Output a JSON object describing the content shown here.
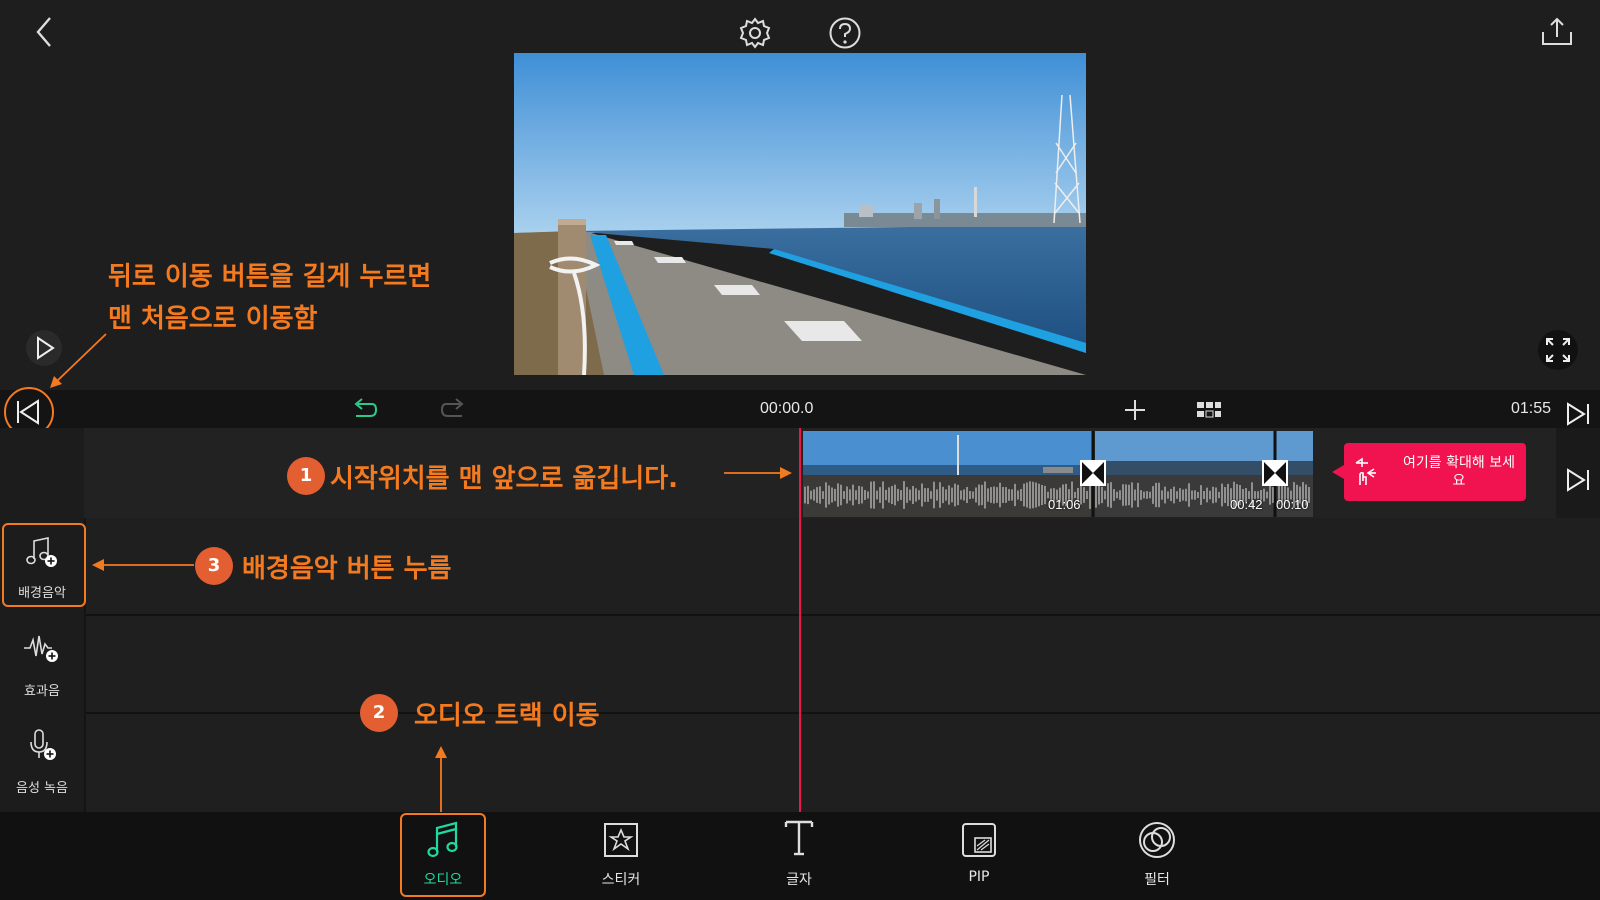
{
  "header": {
    "back_icon": "chevron-left-icon",
    "settings_icon": "gear-icon",
    "help_icon": "question-circle-icon",
    "export_icon": "share-upload-icon"
  },
  "preview": {
    "play_icon": "play-icon",
    "fullscreen_icon": "fullscreen-icon"
  },
  "toolbar": {
    "timecode": "00:00.0",
    "duration": "01:55",
    "icons": [
      "skip-to-start-icon",
      "undo-icon",
      "redo-icon",
      "add-icon",
      "grid-view-icon",
      "skip-to-end-icon"
    ]
  },
  "timeline": {
    "clips": [
      {
        "duration": "01:06"
      },
      {
        "duration": "00:42"
      },
      {
        "duration": "00:10"
      }
    ],
    "zoom_tip": "여기를 확대해 보세요",
    "playhead_color": "#e8174a",
    "tip_color": "#f0134f"
  },
  "rail": {
    "items": [
      {
        "label": "배경음악",
        "icon": "music-note-add-icon"
      },
      {
        "label": "효과음",
        "icon": "waveform-add-icon"
      },
      {
        "label": "음성 녹음",
        "icon": "microphone-add-icon"
      }
    ]
  },
  "bottom_nav": {
    "items": [
      {
        "label": "오디오",
        "icon": "music-notes-icon",
        "active": true
      },
      {
        "label": "스티커",
        "icon": "sticker-star-icon"
      },
      {
        "label": "글자",
        "icon": "text-t-icon"
      },
      {
        "label": "PIP",
        "icon": "pip-icon"
      },
      {
        "label": "필터",
        "icon": "filter-circles-icon"
      }
    ],
    "active_color": "#1ed9a0"
  },
  "annotations": {
    "back_tip_line1": "뒤로 이동 버튼을 길게 누르면",
    "back_tip_line2": "맨 처음으로 이동함",
    "step1_num": "1",
    "step1_text": "시작위치를 맨 앞으로 옮깁니다.",
    "step2_num": "2",
    "step2_text": "오디오 트랙 이동",
    "step3_num": "3",
    "step3_text": "배경음악 버튼 누름",
    "accent_color": "#f47a20"
  }
}
